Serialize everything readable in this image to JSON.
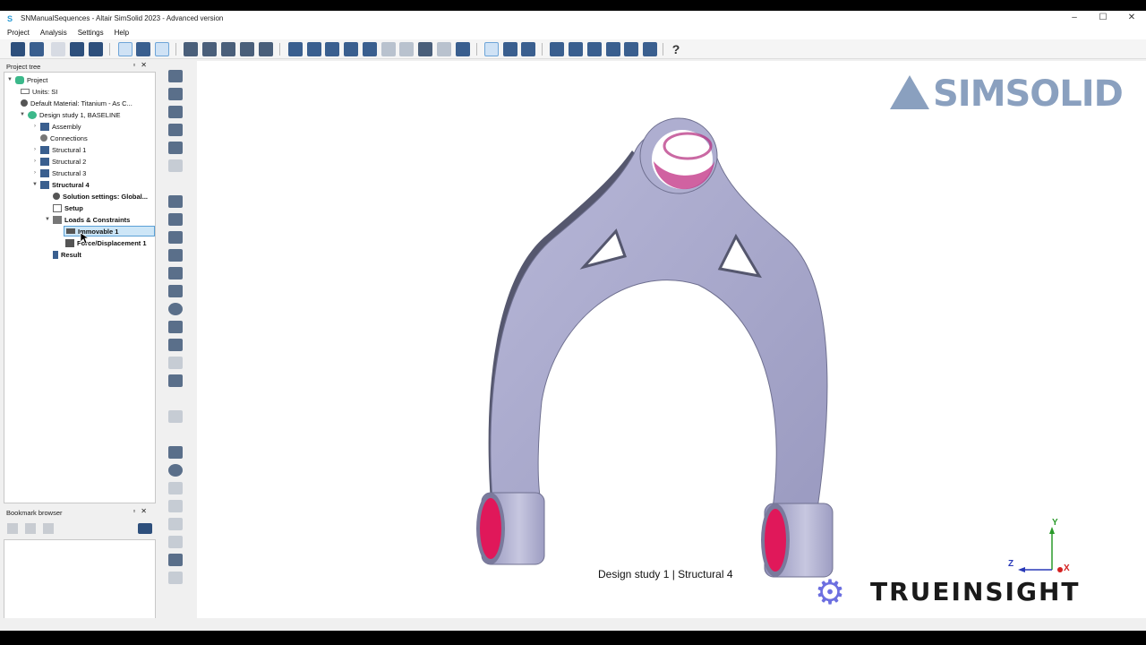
{
  "window": {
    "title": "SNManualSequences - Altair SimSolid 2023 - Advanced version"
  },
  "menu": [
    "Project",
    "Analysis",
    "Settings",
    "Help"
  ],
  "project_tree": {
    "header": "Project tree",
    "items": [
      {
        "label": "Project",
        "bold": false,
        "icon": "simsolid-logo-icon"
      },
      {
        "label": "Units: SI",
        "bold": false,
        "icon": "ruler-icon"
      },
      {
        "label": "Default Material: Titanium - As C...",
        "bold": false,
        "icon": "material-icon"
      },
      {
        "label": "Design study 1, BASELINE",
        "bold": false,
        "icon": "design-study-icon"
      },
      {
        "label": "Assembly",
        "bold": false,
        "icon": "assembly-icon"
      },
      {
        "label": "Connections",
        "bold": false,
        "icon": "connections-icon"
      },
      {
        "label": "Structural  1",
        "bold": false,
        "icon": "structural-icon"
      },
      {
        "label": "Structural  2",
        "bold": false,
        "icon": "structural-icon"
      },
      {
        "label": "Structural  3",
        "bold": false,
        "icon": "structural-icon"
      },
      {
        "label": "Structural  4",
        "bold": true,
        "icon": "structural-icon"
      },
      {
        "label": "Solution settings: Global...",
        "bold": true,
        "icon": "settings-icon"
      },
      {
        "label": "Setup",
        "bold": true,
        "icon": "setup-icon"
      },
      {
        "label": "Loads & Constraints",
        "bold": true,
        "icon": "loads-icon"
      },
      {
        "label": "Immovable 1",
        "bold": true,
        "icon": "immovable-icon"
      },
      {
        "label": "Force/Displacement 1",
        "bold": true,
        "icon": "force-icon"
      },
      {
        "label": "Result",
        "bold": true,
        "icon": "result-icon"
      }
    ]
  },
  "bookmark_browser": {
    "header": "Bookmark browser"
  },
  "viewport": {
    "logo_text": "SIMSOLID",
    "caption": "Design study 1 | Structural  4",
    "watermark": "TRUEINSIGHT",
    "axes": {
      "y": "Y",
      "z": "Z",
      "x": "X"
    }
  },
  "colors": {
    "part": "#a4a4c8",
    "constraint_highlight": "#e0185a",
    "logo": "#8aa0bf",
    "selection": "#cde6f7"
  }
}
